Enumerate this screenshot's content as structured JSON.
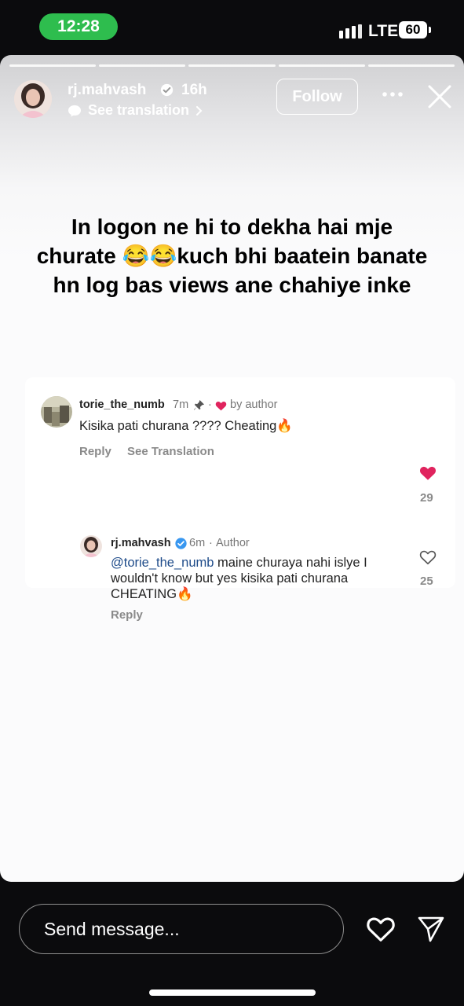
{
  "status_bar": {
    "time": "12:28",
    "network": "LTE",
    "battery": "60"
  },
  "story": {
    "username": "rj.mahvash",
    "time_ago": "16h",
    "see_translation": "See translation",
    "follow_label": "Follow",
    "caption_lines": [
      "In logon ne hi to dekha hai mje",
      "churate 😂😂kuch bhi baatein banate",
      "hn log bas views ane chahiye inke"
    ]
  },
  "comments": {
    "parent": {
      "username": "torie_the_numb",
      "time": "7m",
      "dot": "·",
      "liked_by": "by author",
      "text": "Kisika pati churana ???? Cheating🔥",
      "reply_label": "Reply",
      "translation_label": "See Translation",
      "likes": "29"
    },
    "reply": {
      "username": "rj.mahvash",
      "time": "6m",
      "dot": "·",
      "author_label": "Author",
      "mention": "@torie_the_numb",
      "text_line1": " maine churaya nahi islye I",
      "text_line2": "wouldn't know but yes kisika pati churana",
      "text_line3": "CHEATING🔥",
      "reply_label": "Reply",
      "likes": "25"
    }
  },
  "bottom_bar": {
    "message_placeholder": "Send message..."
  },
  "colors": {
    "status_pill": "#2ebd4e",
    "like_red": "#e0245e",
    "verified_blue": "#3897f0",
    "mention_blue": "#1f4c8a"
  },
  "icons": [
    "verified-icon",
    "translate-icon",
    "chevron-right-icon",
    "more-icon",
    "close-icon",
    "pin-icon",
    "heart-filled-icon",
    "heart-outline-icon",
    "send-icon"
  ]
}
